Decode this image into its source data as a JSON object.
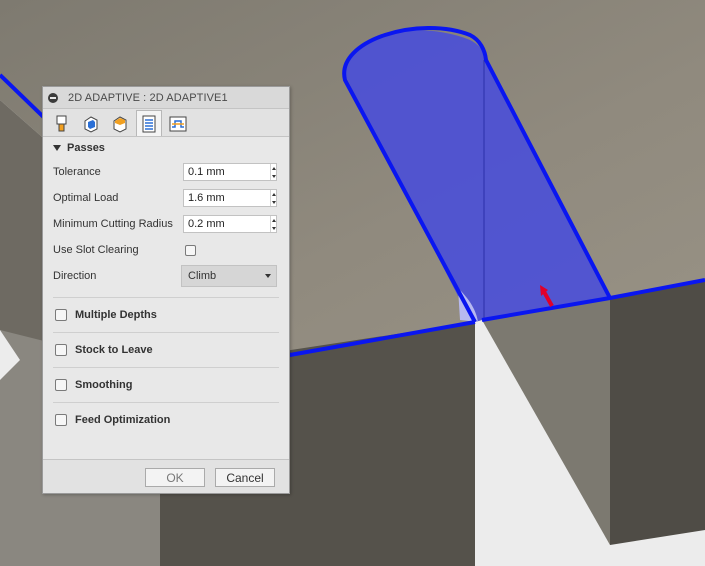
{
  "dialog": {
    "title": "2D ADAPTIVE : 2D ADAPTIVE1",
    "tabs": [
      {
        "icon": "tool-icon",
        "active": false
      },
      {
        "icon": "geometry-icon",
        "active": false
      },
      {
        "icon": "heights-icon",
        "active": false
      },
      {
        "icon": "passes-icon",
        "active": true
      },
      {
        "icon": "linking-icon",
        "active": false
      }
    ],
    "passes": {
      "title": "Passes",
      "tolerance_label": "Tolerance",
      "tolerance_value": "0.1 mm",
      "optimal_load_label": "Optimal Load",
      "optimal_load_value": "1.6 mm",
      "min_cut_radius_label": "Minimum Cutting Radius",
      "min_cut_radius_value": "0.2 mm",
      "slot_clearing_label": "Use Slot Clearing",
      "slot_clearing_checked": false,
      "direction_label": "Direction",
      "direction_value": "Climb"
    },
    "groups": [
      {
        "label": "Multiple Depths",
        "checked": false
      },
      {
        "label": "Stock to Leave",
        "checked": false
      },
      {
        "label": "Smoothing",
        "checked": false
      },
      {
        "label": "Feed Optimization",
        "checked": false
      }
    ],
    "buttons": {
      "ok": "OK",
      "cancel": "Cancel"
    }
  },
  "colors": {
    "selection_edge": "#0a16f0",
    "selection_fill": "#4a4fd8",
    "model_top": "#8a8578",
    "model_side": "#55524b",
    "background": "#ececec",
    "arrow": "#e0002a"
  }
}
